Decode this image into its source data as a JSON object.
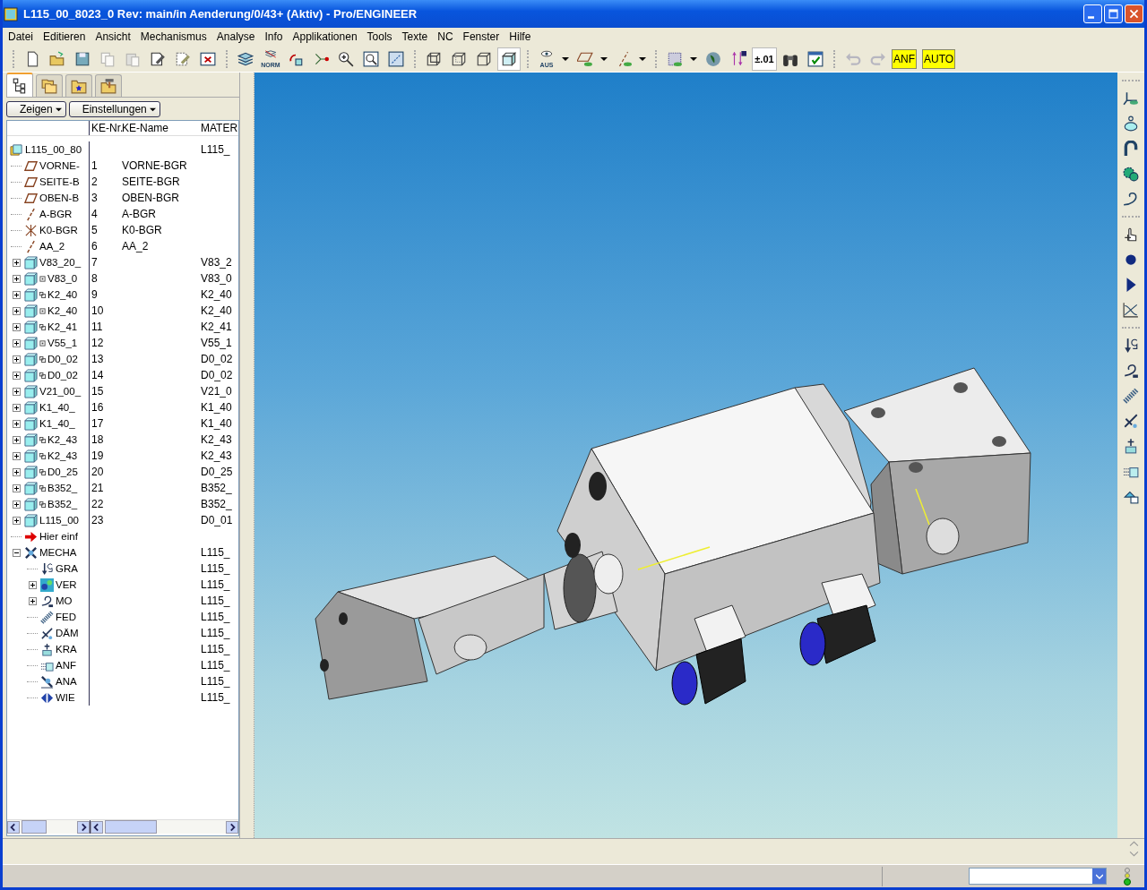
{
  "window": {
    "title": "L115_00_8023_0 Rev: main/in Aenderung/0/43+ (Aktiv) - Pro/ENGINEER"
  },
  "menu": [
    "Datei",
    "Editieren",
    "Ansicht",
    "Mechanismus",
    "Analyse",
    "Info",
    "Applikationen",
    "Tools",
    "Texte",
    "NC",
    "Fenster",
    "Hilfe"
  ],
  "toolbar": {
    "groups": [
      [
        {
          "kind": "new",
          "disabled": false,
          "pressed": false
        },
        {
          "kind": "open",
          "disabled": false,
          "pressed": false
        },
        {
          "kind": "save",
          "disabled": false,
          "pressed": false
        },
        {
          "kind": "copy",
          "disabled": true,
          "pressed": false
        },
        {
          "kind": "paste",
          "disabled": true,
          "pressed": false
        },
        {
          "kind": "edit-doc",
          "disabled": false,
          "pressed": false
        },
        {
          "kind": "erase-doc",
          "disabled": false,
          "pressed": false
        },
        {
          "kind": "close-window",
          "disabled": false,
          "pressed": false
        }
      ],
      [
        {
          "kind": "layers",
          "disabled": false,
          "pressed": false
        },
        {
          "kind": "layers-text",
          "label": "NORM",
          "disabled": false,
          "pressed": false
        },
        {
          "kind": "repaint",
          "disabled": false,
          "pressed": false
        },
        {
          "kind": "nodes",
          "disabled": false,
          "pressed": false
        },
        {
          "kind": "zoom-in",
          "disabled": false,
          "pressed": false
        },
        {
          "kind": "zoom-window",
          "disabled": false,
          "pressed": false
        },
        {
          "kind": "refit",
          "disabled": false,
          "pressed": false
        }
      ],
      [
        {
          "kind": "wireframe",
          "disabled": false,
          "pressed": false
        },
        {
          "kind": "hidden-line",
          "disabled": false,
          "pressed": false
        },
        {
          "kind": "no-hidden",
          "disabled": false,
          "pressed": false
        },
        {
          "kind": "shaded",
          "disabled": false,
          "pressed": true
        }
      ],
      [
        {
          "kind": "eye",
          "label": "AUS",
          "disabled": false,
          "pressed": false,
          "dropdown": true
        },
        {
          "kind": "plane-eye",
          "disabled": false,
          "pressed": false,
          "dropdown": true
        },
        {
          "kind": "axis-eye",
          "disabled": false,
          "pressed": false,
          "dropdown": true
        }
      ],
      [
        {
          "kind": "grid",
          "disabled": false,
          "pressed": false,
          "dropdown": true
        },
        {
          "kind": "globe",
          "disabled": false,
          "pressed": false
        },
        {
          "kind": "dimension",
          "disabled": false,
          "pressed": false
        },
        {
          "kind": "text",
          "label": "±.01",
          "disabled": false,
          "pressed": true
        },
        {
          "kind": "binoculars",
          "disabled": false,
          "pressed": false
        },
        {
          "kind": "window-check",
          "disabled": false,
          "pressed": false
        }
      ],
      [
        {
          "kind": "undo",
          "disabled": true,
          "pressed": false
        },
        {
          "kind": "redo",
          "disabled": true,
          "pressed": false
        },
        {
          "kind": "yellow",
          "label": "ANF",
          "disabled": false,
          "pressed": false
        },
        {
          "kind": "yellow",
          "label": "AUTO",
          "disabled": false,
          "pressed": false
        }
      ]
    ]
  },
  "panel": {
    "tabs": [
      {
        "kind": "tree",
        "selected": true
      },
      {
        "kind": "folders",
        "selected": false
      },
      {
        "kind": "star-folder",
        "selected": false
      },
      {
        "kind": "tool-folder",
        "selected": false
      }
    ],
    "buttons": [
      "Zeigen",
      "Einstellungen"
    ],
    "columns": [
      "KE-Nr.",
      "KE-Name",
      "MATER"
    ]
  },
  "model_tree": {
    "rows": [
      {
        "kind": "assembly",
        "name": "L115_00_80",
        "material": "L115_",
        "children": [
          {
            "kind": "plane",
            "name": "VORNE-",
            "nr": "1",
            "ke_name": "VORNE-BGR"
          },
          {
            "kind": "plane",
            "name": "SEITE-B",
            "nr": "2",
            "ke_name": "SEITE-BGR"
          },
          {
            "kind": "plane",
            "name": "OBEN-B",
            "nr": "3",
            "ke_name": "OBEN-BGR"
          },
          {
            "kind": "axis",
            "name": "A-BGR",
            "nr": "4",
            "ke_name": "A-BGR"
          },
          {
            "kind": "csys",
            "name": "K0-BGR",
            "nr": "5",
            "ke_name": "K0-BGR"
          },
          {
            "kind": "axis",
            "name": "AA_2",
            "nr": "6",
            "ke_name": "AA_2"
          },
          {
            "kind": "part",
            "name": "V83_20_",
            "nr": "7",
            "material": "V83_2",
            "expanded": false
          },
          {
            "kind": "part",
            "flag": {
              "kind": "square"
            },
            "name": "V83_0",
            "nr": "8",
            "material": "V83_0",
            "expanded": false
          },
          {
            "kind": "part",
            "flag": {
              "kind": "link"
            },
            "name": "K2_40",
            "nr": "9",
            "material": "K2_40",
            "expanded": false
          },
          {
            "kind": "part",
            "flag": {
              "kind": "square"
            },
            "name": "K2_40",
            "nr": "10",
            "material": "K2_40",
            "expanded": false
          },
          {
            "kind": "part",
            "flag": {
              "kind": "link"
            },
            "name": "K2_41",
            "nr": "11",
            "material": "K2_41",
            "expanded": false
          },
          {
            "kind": "part",
            "flag": {
              "kind": "square"
            },
            "name": "V55_1",
            "nr": "12",
            "material": "V55_1",
            "expanded": false
          },
          {
            "kind": "part",
            "flag": {
              "kind": "link"
            },
            "name": "D0_02",
            "nr": "13",
            "material": "D0_02",
            "expanded": false
          },
          {
            "kind": "part",
            "flag": {
              "kind": "link"
            },
            "name": "D0_02",
            "nr": "14",
            "material": "D0_02",
            "expanded": false
          },
          {
            "kind": "part",
            "name": "V21_00_",
            "nr": "15",
            "material": "V21_0",
            "expanded": false
          },
          {
            "kind": "part",
            "name": "K1_40_",
            "nr": "16",
            "material": "K1_40",
            "expanded": false
          },
          {
            "kind": "part",
            "name": "K1_40_",
            "nr": "17",
            "material": "K1_40",
            "expanded": false
          },
          {
            "kind": "part",
            "flag": {
              "kind": "link"
            },
            "name": "K2_43",
            "nr": "18",
            "material": "K2_43",
            "expanded": false
          },
          {
            "kind": "part",
            "flag": {
              "kind": "link"
            },
            "name": "K2_43",
            "nr": "19",
            "material": "K2_43",
            "expanded": false
          },
          {
            "kind": "part",
            "flag": {
              "kind": "link"
            },
            "name": "D0_25",
            "nr": "20",
            "material": "D0_25",
            "expanded": false
          },
          {
            "kind": "part",
            "flag": {
              "kind": "link"
            },
            "name": "B352_",
            "nr": "21",
            "material": "B352_",
            "expanded": false
          },
          {
            "kind": "part",
            "flag": {
              "kind": "link"
            },
            "name": "B352_",
            "nr": "22",
            "material": "B352_",
            "expanded": false
          },
          {
            "kind": "part",
            "name": "L115_00",
            "nr": "23",
            "material": "D0_01",
            "expanded": false
          },
          {
            "kind": "insert",
            "name": "Hier einf"
          },
          {
            "kind": "mechanism",
            "name": "MECHA",
            "material": "L115_",
            "expanded": true,
            "children": [
              {
                "kind": "gravity",
                "name": "GRA",
                "material": "L115_"
              },
              {
                "kind": "connection",
                "name": "VER",
                "material": "L115_",
                "expanded": false
              },
              {
                "kind": "motor",
                "name": "MO",
                "material": "L115_",
                "expanded": false
              },
              {
                "kind": "spring",
                "name": "FED",
                "material": "L115_"
              },
              {
                "kind": "damper",
                "name": "DÄM",
                "material": "L115_"
              },
              {
                "kind": "force",
                "name": "KRA",
                "material": "L115_"
              },
              {
                "kind": "initial",
                "name": "ANF",
                "material": "L115_"
              },
              {
                "kind": "analysis",
                "name": "ANA",
                "material": "L115_"
              },
              {
                "kind": "playback",
                "name": "WIE",
                "material": "L115_"
              }
            ]
          }
        ]
      }
    ]
  },
  "right_toolbar": {
    "groups": [
      [
        {
          "kind": "drag-csys"
        },
        {
          "kind": "joint-axis"
        },
        {
          "kind": "cam"
        },
        {
          "kind": "gear"
        },
        {
          "kind": "belt"
        }
      ],
      [
        {
          "kind": "drag-hand"
        },
        {
          "kind": "record"
        },
        {
          "kind": "play"
        },
        {
          "kind": "graph"
        }
      ],
      [
        {
          "kind": "gravity"
        },
        {
          "kind": "motor"
        },
        {
          "kind": "spring"
        },
        {
          "kind": "damper"
        },
        {
          "kind": "force"
        },
        {
          "kind": "initial"
        },
        {
          "kind": "mass"
        }
      ]
    ]
  }
}
